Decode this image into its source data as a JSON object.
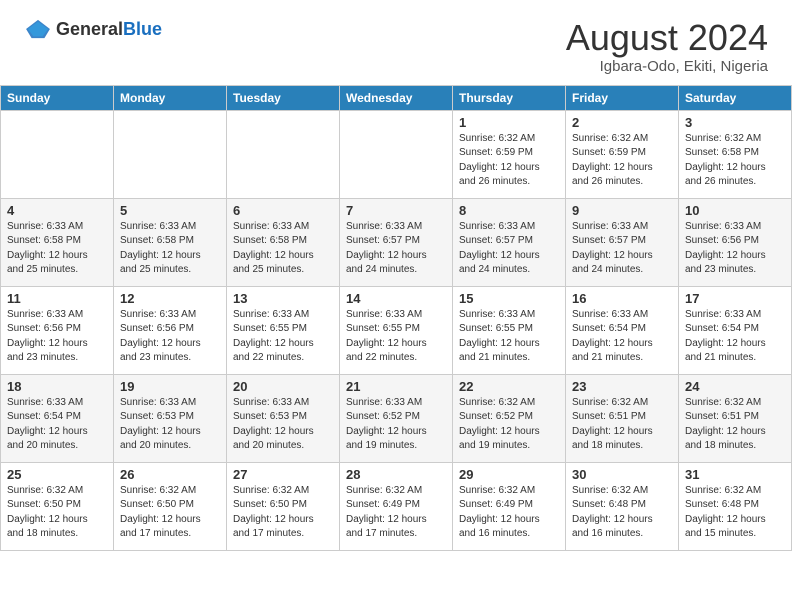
{
  "header": {
    "logo_general": "General",
    "logo_blue": "Blue",
    "title": "August 2024",
    "subtitle": "Igbara-Odo, Ekiti, Nigeria"
  },
  "days_of_week": [
    "Sunday",
    "Monday",
    "Tuesday",
    "Wednesday",
    "Thursday",
    "Friday",
    "Saturday"
  ],
  "weeks": [
    [
      {
        "day": "",
        "info": ""
      },
      {
        "day": "",
        "info": ""
      },
      {
        "day": "",
        "info": ""
      },
      {
        "day": "",
        "info": ""
      },
      {
        "day": "1",
        "info": "Sunrise: 6:32 AM\nSunset: 6:59 PM\nDaylight: 12 hours\nand 26 minutes."
      },
      {
        "day": "2",
        "info": "Sunrise: 6:32 AM\nSunset: 6:59 PM\nDaylight: 12 hours\nand 26 minutes."
      },
      {
        "day": "3",
        "info": "Sunrise: 6:32 AM\nSunset: 6:58 PM\nDaylight: 12 hours\nand 26 minutes."
      }
    ],
    [
      {
        "day": "4",
        "info": "Sunrise: 6:33 AM\nSunset: 6:58 PM\nDaylight: 12 hours\nand 25 minutes."
      },
      {
        "day": "5",
        "info": "Sunrise: 6:33 AM\nSunset: 6:58 PM\nDaylight: 12 hours\nand 25 minutes."
      },
      {
        "day": "6",
        "info": "Sunrise: 6:33 AM\nSunset: 6:58 PM\nDaylight: 12 hours\nand 25 minutes."
      },
      {
        "day": "7",
        "info": "Sunrise: 6:33 AM\nSunset: 6:57 PM\nDaylight: 12 hours\nand 24 minutes."
      },
      {
        "day": "8",
        "info": "Sunrise: 6:33 AM\nSunset: 6:57 PM\nDaylight: 12 hours\nand 24 minutes."
      },
      {
        "day": "9",
        "info": "Sunrise: 6:33 AM\nSunset: 6:57 PM\nDaylight: 12 hours\nand 24 minutes."
      },
      {
        "day": "10",
        "info": "Sunrise: 6:33 AM\nSunset: 6:56 PM\nDaylight: 12 hours\nand 23 minutes."
      }
    ],
    [
      {
        "day": "11",
        "info": "Sunrise: 6:33 AM\nSunset: 6:56 PM\nDaylight: 12 hours\nand 23 minutes."
      },
      {
        "day": "12",
        "info": "Sunrise: 6:33 AM\nSunset: 6:56 PM\nDaylight: 12 hours\nand 23 minutes."
      },
      {
        "day": "13",
        "info": "Sunrise: 6:33 AM\nSunset: 6:55 PM\nDaylight: 12 hours\nand 22 minutes."
      },
      {
        "day": "14",
        "info": "Sunrise: 6:33 AM\nSunset: 6:55 PM\nDaylight: 12 hours\nand 22 minutes."
      },
      {
        "day": "15",
        "info": "Sunrise: 6:33 AM\nSunset: 6:55 PM\nDaylight: 12 hours\nand 21 minutes."
      },
      {
        "day": "16",
        "info": "Sunrise: 6:33 AM\nSunset: 6:54 PM\nDaylight: 12 hours\nand 21 minutes."
      },
      {
        "day": "17",
        "info": "Sunrise: 6:33 AM\nSunset: 6:54 PM\nDaylight: 12 hours\nand 21 minutes."
      }
    ],
    [
      {
        "day": "18",
        "info": "Sunrise: 6:33 AM\nSunset: 6:54 PM\nDaylight: 12 hours\nand 20 minutes."
      },
      {
        "day": "19",
        "info": "Sunrise: 6:33 AM\nSunset: 6:53 PM\nDaylight: 12 hours\nand 20 minutes."
      },
      {
        "day": "20",
        "info": "Sunrise: 6:33 AM\nSunset: 6:53 PM\nDaylight: 12 hours\nand 20 minutes."
      },
      {
        "day": "21",
        "info": "Sunrise: 6:33 AM\nSunset: 6:52 PM\nDaylight: 12 hours\nand 19 minutes."
      },
      {
        "day": "22",
        "info": "Sunrise: 6:32 AM\nSunset: 6:52 PM\nDaylight: 12 hours\nand 19 minutes."
      },
      {
        "day": "23",
        "info": "Sunrise: 6:32 AM\nSunset: 6:51 PM\nDaylight: 12 hours\nand 18 minutes."
      },
      {
        "day": "24",
        "info": "Sunrise: 6:32 AM\nSunset: 6:51 PM\nDaylight: 12 hours\nand 18 minutes."
      }
    ],
    [
      {
        "day": "25",
        "info": "Sunrise: 6:32 AM\nSunset: 6:50 PM\nDaylight: 12 hours\nand 18 minutes."
      },
      {
        "day": "26",
        "info": "Sunrise: 6:32 AM\nSunset: 6:50 PM\nDaylight: 12 hours\nand 17 minutes."
      },
      {
        "day": "27",
        "info": "Sunrise: 6:32 AM\nSunset: 6:50 PM\nDaylight: 12 hours\nand 17 minutes."
      },
      {
        "day": "28",
        "info": "Sunrise: 6:32 AM\nSunset: 6:49 PM\nDaylight: 12 hours\nand 17 minutes."
      },
      {
        "day": "29",
        "info": "Sunrise: 6:32 AM\nSunset: 6:49 PM\nDaylight: 12 hours\nand 16 minutes."
      },
      {
        "day": "30",
        "info": "Sunrise: 6:32 AM\nSunset: 6:48 PM\nDaylight: 12 hours\nand 16 minutes."
      },
      {
        "day": "31",
        "info": "Sunrise: 6:32 AM\nSunset: 6:48 PM\nDaylight: 12 hours\nand 15 minutes."
      }
    ]
  ]
}
